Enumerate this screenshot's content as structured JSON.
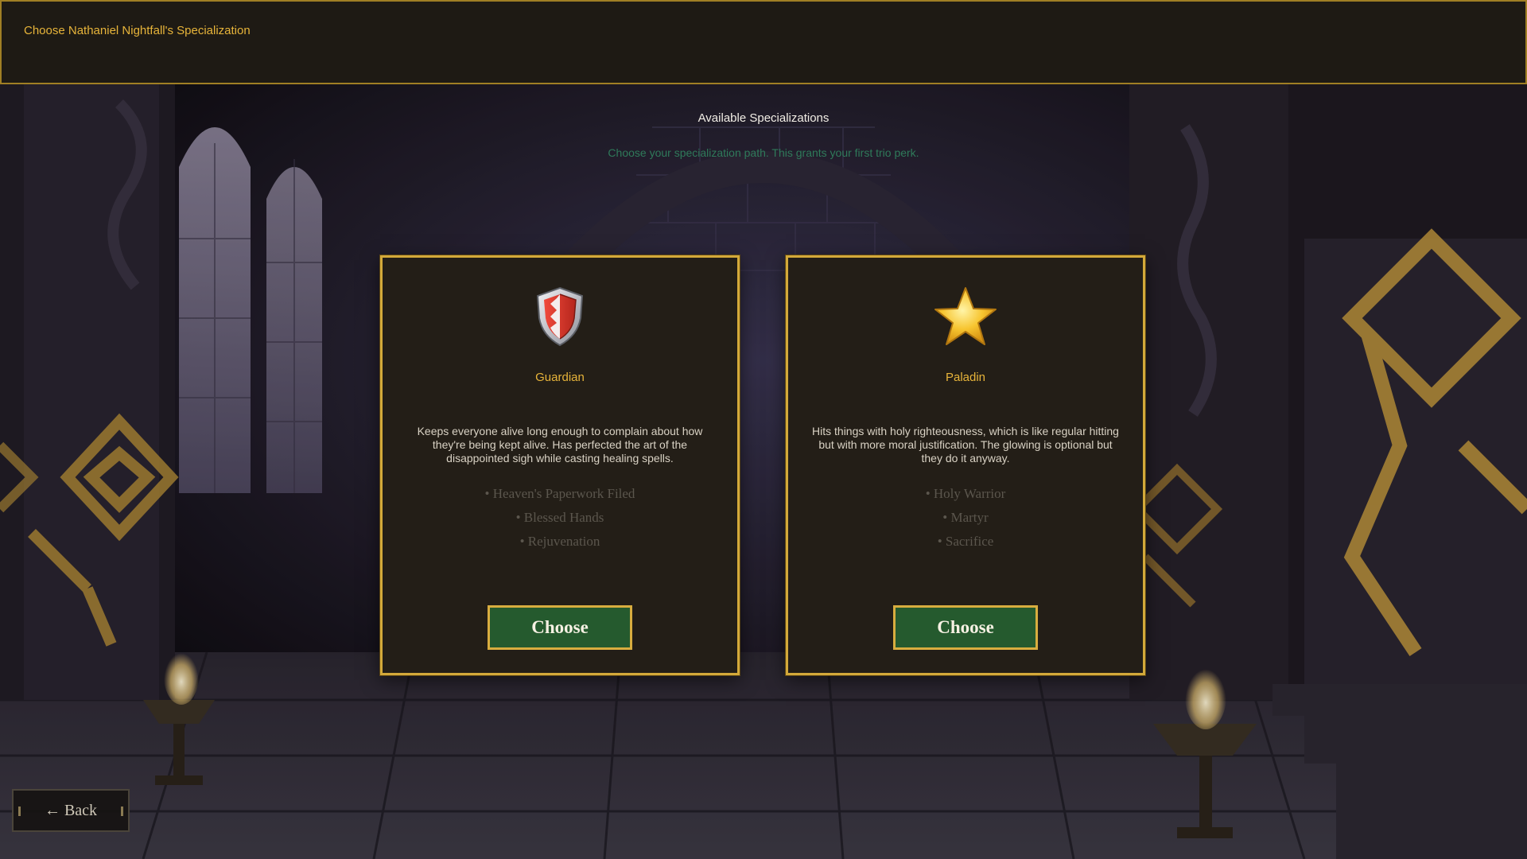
{
  "header": {
    "title": "Choose Nathaniel Nightfall's Specialization"
  },
  "section": {
    "title": "Available Specializations",
    "subtitle": "Choose your specialization path. This grants your first trio perk."
  },
  "cards": [
    {
      "name": "Guardian",
      "icon": "shield-icon",
      "description": "Keeps everyone alive long enough to complain about how they're being kept alive. Has perfected the art of the disappointed sigh while casting healing spells.",
      "perks": [
        "• Heaven's Paperwork Filed",
        "• Blessed Hands",
        "• Rejuvenation"
      ],
      "button_label": "Choose"
    },
    {
      "name": "Paladin",
      "icon": "star-icon",
      "description": "Hits things with holy righteousness, which is like regular hitting but with more moral justification. The glowing is optional but they do it anyway.",
      "perks": [
        "• Holy Warrior",
        "• Martyr",
        "• Sacrifice"
      ],
      "button_label": "Choose"
    }
  ],
  "back_button": {
    "label": "← Back"
  },
  "colors": {
    "gold_accent": "#e7b43a",
    "card_border": "#d3a93a",
    "button_green": "#255a2e",
    "subtitle_green": "#2f7a5a",
    "header_bg": "#1e1a14"
  }
}
